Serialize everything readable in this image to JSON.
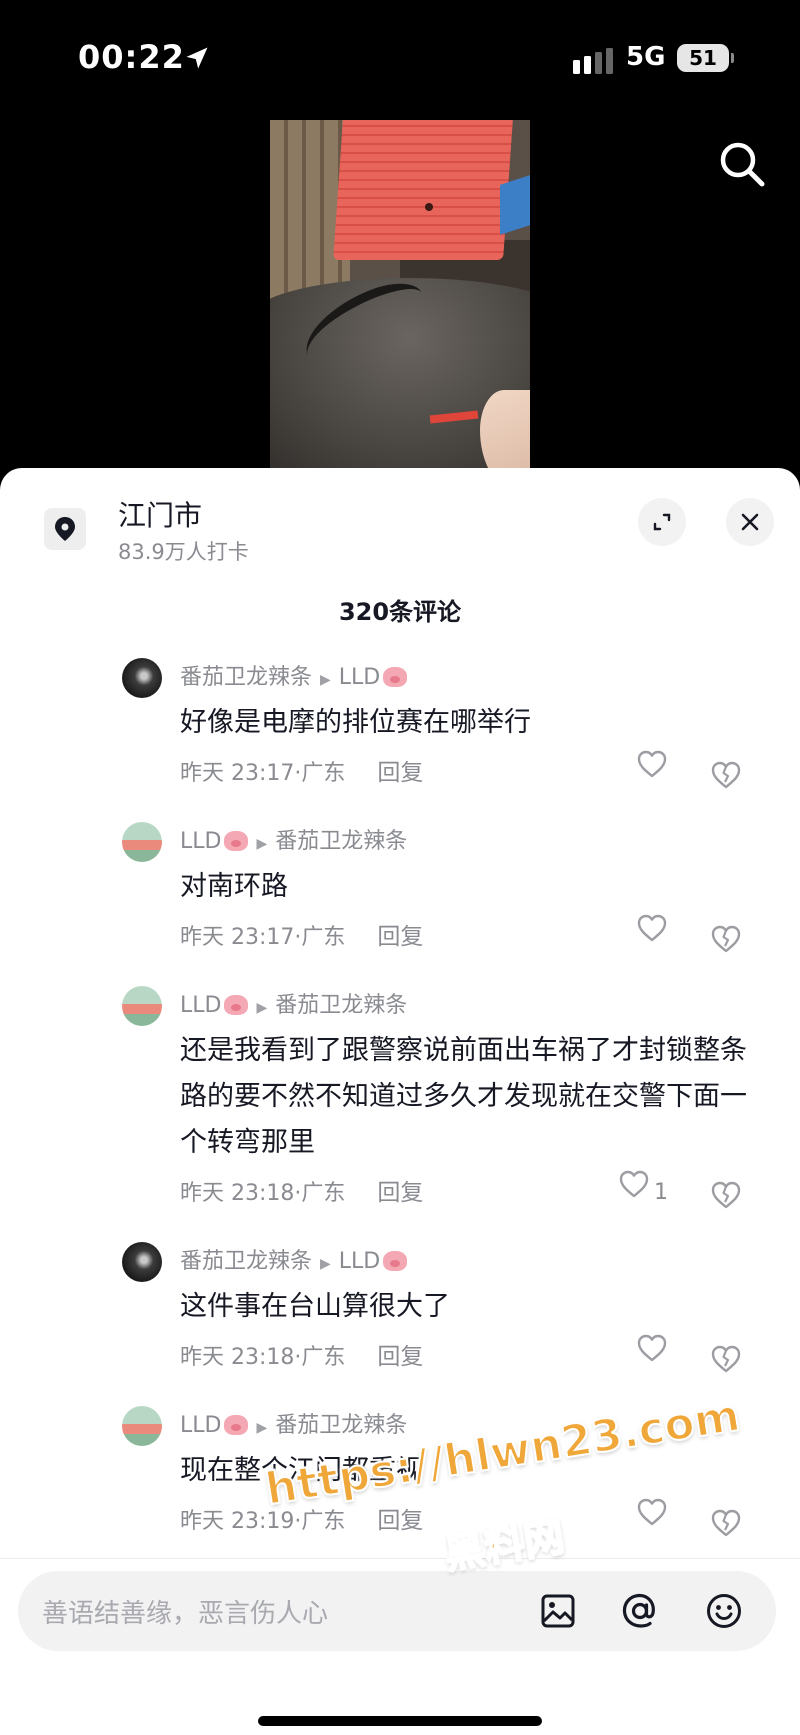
{
  "status_bar": {
    "time": "00:22",
    "network": "5G",
    "battery": "51"
  },
  "location": {
    "name": "江门市",
    "checkins": "83.9万人打卡"
  },
  "comment_count": "320条评论",
  "comments": [
    {
      "user": "番茄卫龙辣条",
      "reply_to": "LLD",
      "text": "好像是电摩的排位赛在哪举行",
      "time": "昨天 23:17·广东",
      "reply": "回复",
      "likes": "",
      "avatar": "dark"
    },
    {
      "user": "LLD",
      "reply_to": "番茄卫龙辣条",
      "text": "对南环路",
      "time": "昨天 23:17·广东",
      "reply": "回复",
      "likes": "",
      "avatar": "light"
    },
    {
      "user": "LLD",
      "reply_to": "番茄卫龙辣条",
      "text": "还是我看到了跟警察说前面出车祸了才封锁整条路的要不然不知道过多久才发现就在交警下面一个转弯那里",
      "time": "昨天 23:18·广东",
      "reply": "回复",
      "likes": "1",
      "avatar": "light"
    },
    {
      "user": "番茄卫龙辣条",
      "reply_to": "LLD",
      "text": "这件事在台山算很大了",
      "time": "昨天 23:18·广东",
      "reply": "回复",
      "likes": "",
      "avatar": "dark"
    },
    {
      "user": "LLD",
      "reply_to": "番茄卫龙辣条",
      "text": "现在整个江门都重视",
      "time": "昨天 23:19·广东",
      "reply": "回复",
      "likes": "",
      "avatar": "light"
    }
  ],
  "input": {
    "placeholder": "善语结善缘，恶言伤人心"
  },
  "watermark": {
    "url": "https://hlwn23.com",
    "name": "黑料网"
  },
  "icons": [
    "location-arrow-icon",
    "signal-icon",
    "search-icon",
    "location-pin-icon",
    "expand-icon",
    "close-icon",
    "heart-icon",
    "dislike-heart-icon",
    "image-icon",
    "at-icon",
    "emoji-icon"
  ]
}
